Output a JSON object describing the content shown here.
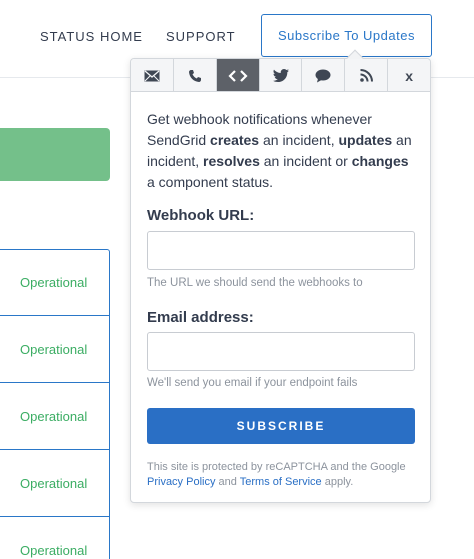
{
  "nav": {
    "status_home": "STATUS HOME",
    "support": "SUPPORT",
    "subscribe_updates": "Subscribe To Updates"
  },
  "components": [
    {
      "status": "Operational"
    },
    {
      "status": "Operational"
    },
    {
      "status": "Operational"
    },
    {
      "status": "Operational"
    },
    {
      "status": "Operational"
    }
  ],
  "popup": {
    "tabs": [
      {
        "icon": "email-icon"
      },
      {
        "icon": "phone-icon"
      },
      {
        "icon": "webhook-icon",
        "active": true
      },
      {
        "icon": "twitter-icon"
      },
      {
        "icon": "chat-icon"
      },
      {
        "icon": "rss-icon"
      },
      {
        "icon": "close-icon",
        "label": "x"
      }
    ],
    "intro": {
      "p1": "Get webhook notifications whenever SendGrid ",
      "b1": "creates",
      "p2": " an incident, ",
      "b2": "updates",
      "p3": " an incident, ",
      "b3": "resolves",
      "p4": " an incident or ",
      "b4": "changes",
      "p5": " a component status."
    },
    "webhook_label": "Webhook URL:",
    "webhook_value": "",
    "webhook_hint": "The URL we should send the webhooks to",
    "email_label": "Email address:",
    "email_value": "",
    "email_hint": "We'll send you email if your endpoint fails",
    "subscribe_label": "SUBSCRIBE",
    "recaptcha": {
      "text1": "This site is protected by reCAPTCHA and the Google ",
      "privacy": "Privacy Policy",
      "and": " and ",
      "terms": "Terms of Service",
      "text2": " apply."
    }
  },
  "colors": {
    "accent": "#2a6fc5",
    "operational": "#3bad63",
    "banner": "#74c08a"
  }
}
